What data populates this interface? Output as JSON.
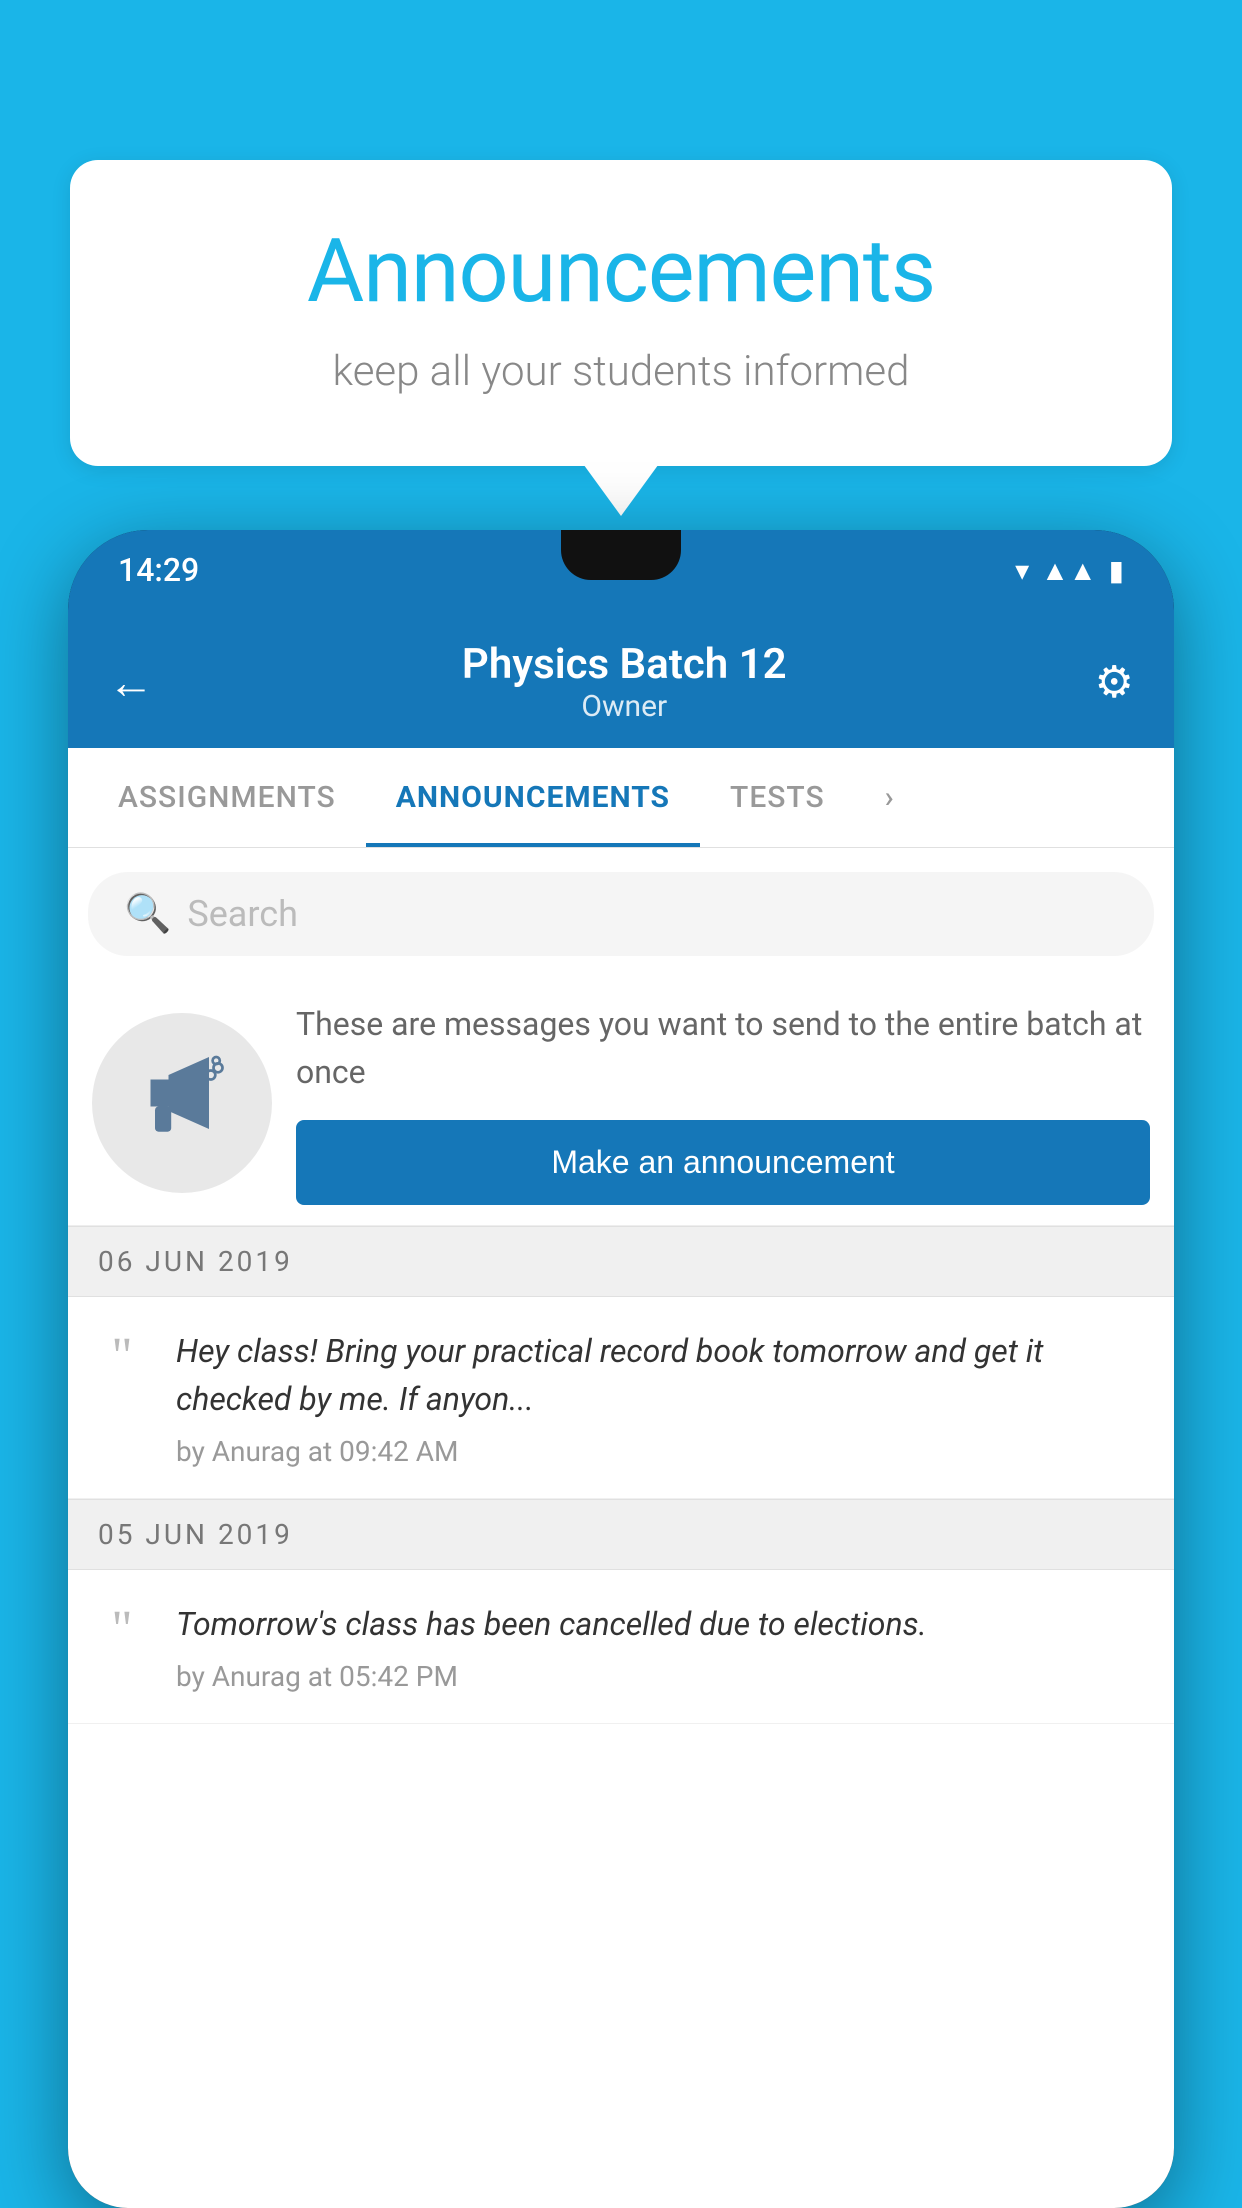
{
  "background_color": "#1ab5e8",
  "speech_bubble": {
    "title": "Announcements",
    "subtitle": "keep all your students informed"
  },
  "phone": {
    "status_bar": {
      "time": "14:29",
      "icons": [
        "wifi",
        "signal",
        "battery"
      ]
    },
    "header": {
      "back_label": "←",
      "title": "Physics Batch 12",
      "subtitle": "Owner",
      "settings_label": "⚙"
    },
    "tabs": [
      {
        "label": "ASSIGNMENTS",
        "active": false
      },
      {
        "label": "ANNOUNCEMENTS",
        "active": true
      },
      {
        "label": "TESTS",
        "active": false
      },
      {
        "label": "...",
        "active": false
      }
    ],
    "search": {
      "placeholder": "Search"
    },
    "promo": {
      "icon": "📣",
      "description": "These are messages you want to send to the entire batch at once",
      "button_label": "Make an announcement"
    },
    "announcements": [
      {
        "date": "06  JUN  2019",
        "text": "Hey class! Bring your practical record book tomorrow and get it checked by me. If anyon...",
        "meta": "by Anurag at 09:42 AM"
      },
      {
        "date": "05  JUN  2019",
        "text": "Tomorrow's class has been cancelled due to elections.",
        "meta": "by Anurag at 05:42 PM"
      }
    ]
  }
}
